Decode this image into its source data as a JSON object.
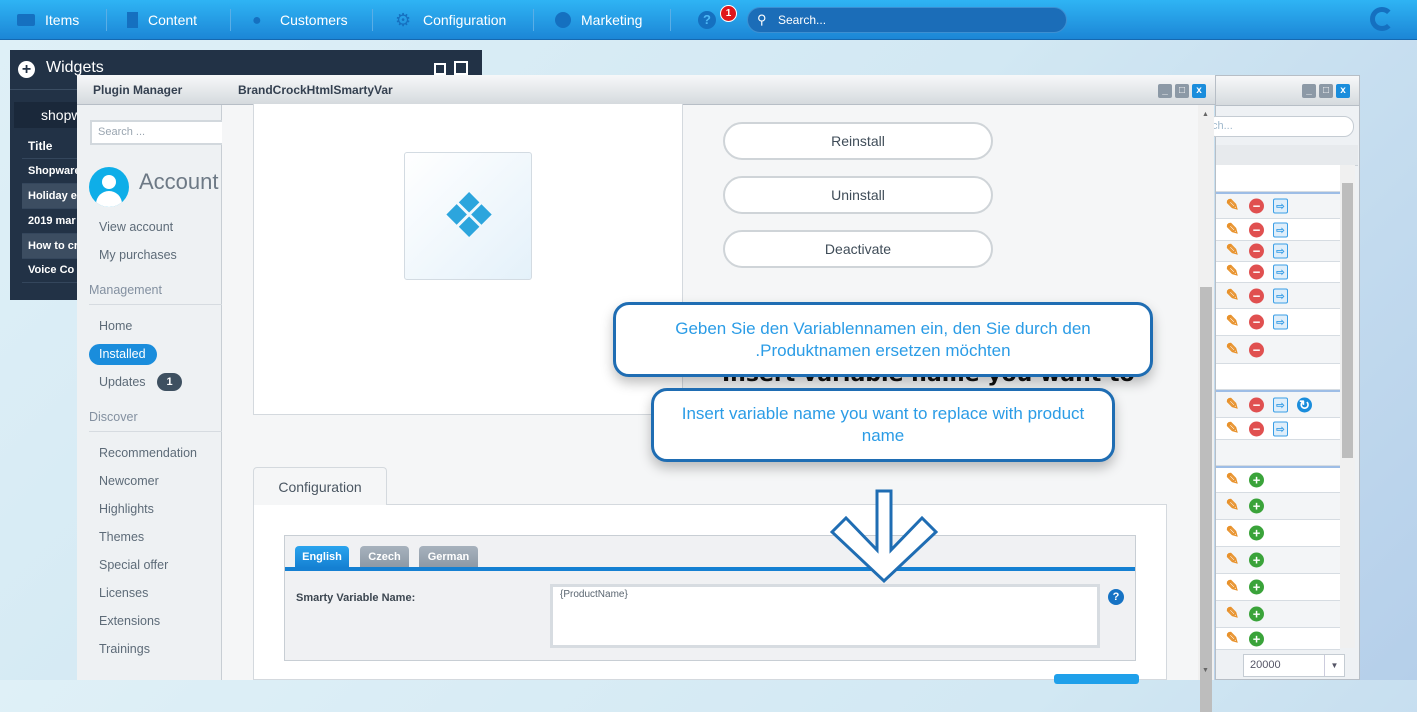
{
  "topbar": {
    "items": [
      {
        "label": "Items",
        "icon": "inbox-icon"
      },
      {
        "label": "Content",
        "icon": "document-icon"
      },
      {
        "label": "Customers",
        "icon": "users-icon"
      },
      {
        "label": "Configuration",
        "icon": "gear-icon"
      },
      {
        "label": "Marketing",
        "icon": "pie-chart-icon"
      }
    ],
    "help_badge": "1",
    "search_placeholder": "Search..."
  },
  "widgets": {
    "title": "Widgets",
    "tab": "shopw",
    "rows": [
      "Title",
      "Shopware",
      "Holiday e",
      "2019 mar",
      "How to cr",
      "Voice Co"
    ]
  },
  "plugin_manager": {
    "title": "Plugin Manager",
    "search_placeholder": "Search ...",
    "account_title": "Account",
    "account_links": [
      "View account",
      "My purchases"
    ],
    "management_header": "Management",
    "management": [
      "Home",
      "Installed",
      "Updates"
    ],
    "updates_badge": "1",
    "discover_header": "Discover",
    "discover": [
      "Recommendation",
      "Newcomer",
      "Highlights",
      "Themes",
      "Special offer",
      "Licenses",
      "Extensions",
      "Trainings"
    ]
  },
  "detail": {
    "title": "BrandCrockHtmlSmartyVar",
    "buttons": [
      "Reinstall",
      "Uninstall",
      "Deactivate"
    ],
    "hidden_heading": "Insert variable name you want to",
    "config_tab": "Configuration",
    "lang_tabs": [
      "English",
      "Czech",
      "German"
    ],
    "field_label": "Smarty Variable Name:",
    "field_value": "{ProductName}"
  },
  "callouts": {
    "german": "Geben Sie den Variablennamen ein, den Sie durch den .Produktnamen ersetzen möchten",
    "english": "Insert variable name you want to replace with product name"
  },
  "right_window": {
    "search_placeholder": "ch...",
    "page_size": "20000",
    "rows": [
      {
        "actions": []
      },
      {
        "actions": [
          "edit",
          "remove",
          "install"
        ]
      },
      {
        "actions": [
          "edit",
          "remove",
          "install"
        ]
      },
      {
        "actions": [
          "edit",
          "remove",
          "install"
        ]
      },
      {
        "actions": [
          "edit",
          "remove",
          "install"
        ]
      },
      {
        "actions": [
          "edit",
          "remove",
          "install"
        ]
      },
      {
        "actions": [
          "edit",
          "remove",
          "install"
        ]
      },
      {
        "actions": [
          "edit",
          "remove"
        ]
      },
      {
        "actions": []
      },
      {
        "actions": [
          "edit",
          "remove",
          "install",
          "update"
        ]
      },
      {
        "actions": [
          "edit",
          "remove",
          "install"
        ]
      },
      {
        "actions": []
      },
      {
        "actions": [
          "edit",
          "add"
        ]
      },
      {
        "actions": [
          "edit",
          "add"
        ]
      },
      {
        "actions": [
          "edit",
          "add"
        ]
      },
      {
        "actions": [
          "edit",
          "add"
        ]
      },
      {
        "actions": [
          "edit",
          "add"
        ]
      },
      {
        "actions": [
          "edit",
          "add"
        ]
      },
      {
        "actions": [
          "edit",
          "add"
        ]
      }
    ]
  },
  "colors": {
    "accent": "#1a8ddc",
    "callout_border": "#1f6db3",
    "callout_text": "#2b9ce6",
    "topbar": "#2fb4f4"
  }
}
